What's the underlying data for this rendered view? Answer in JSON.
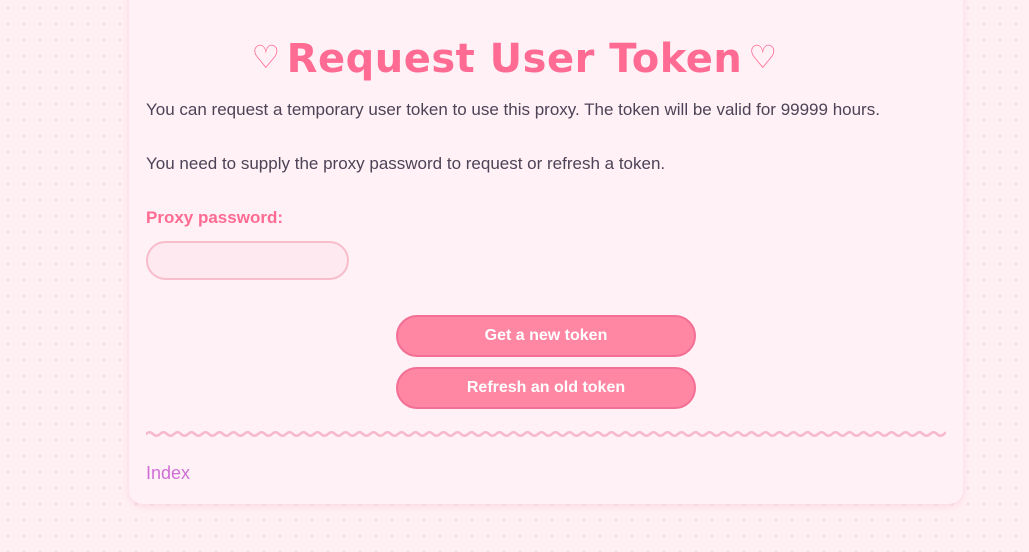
{
  "page": {
    "title": "Request User Token",
    "title_icon_left": "heart-outline-icon",
    "title_icon_right": "heart-outline-icon",
    "heart_glyph": "♡"
  },
  "intro": {
    "line1": "You can request a temporary user token to use this proxy. The token will be valid for 99999 hours.",
    "line2": "You need to supply the proxy password to request or refresh a token."
  },
  "form": {
    "password_label": "Proxy password:",
    "password_value": "",
    "password_placeholder": "",
    "new_token_button": "Get a new token",
    "refresh_token_button": "Refresh an old token"
  },
  "footer": {
    "index_link": "Index"
  },
  "colors": {
    "accent": "#ff6b93",
    "button_bg": "#ff87a3",
    "button_border": "#f36f95",
    "input_bg": "#ffe9f0",
    "input_border": "#f8bdcc",
    "link": "#cf6fd6",
    "text": "#4d4357",
    "page_bg": "#fff0f4"
  }
}
